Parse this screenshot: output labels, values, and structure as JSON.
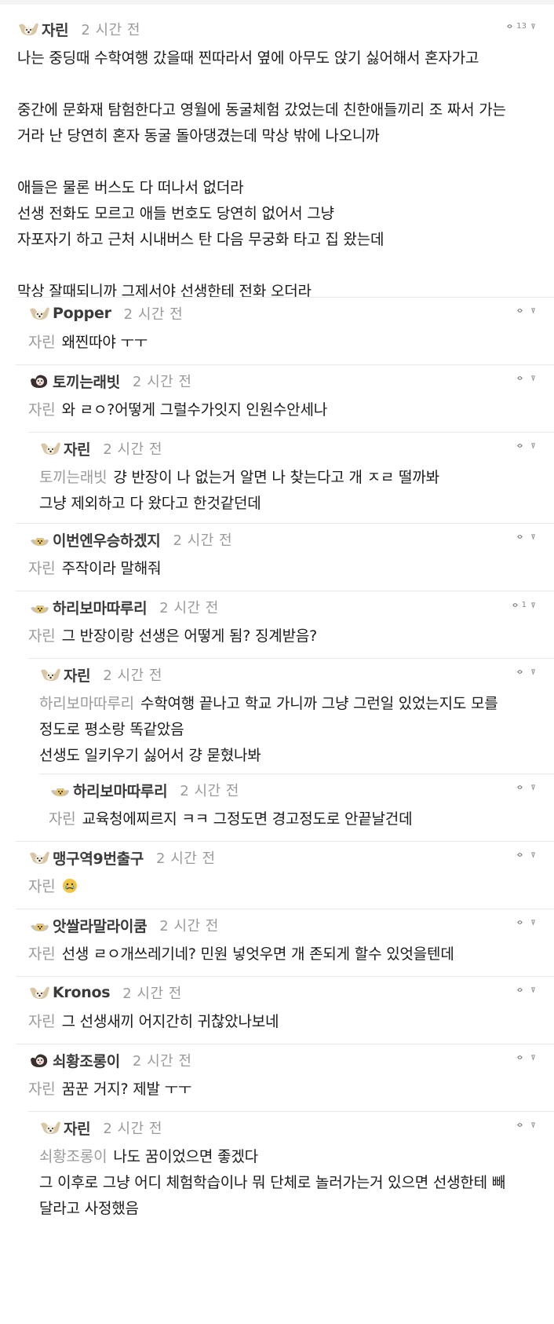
{
  "comments": [
    {
      "nick": "자린",
      "time": "2 시간 전",
      "up": "13",
      "down": "",
      "lines": [
        "나는 중딩때 수학여행 갔을때 찐따라서 옆에 아무도 앉기 싫어해서 혼자가고",
        "",
        "중간에 문화재 탐험한다고 영월에 동굴체험 갔었는데 친한애들끼리 조 짜서 가는",
        "거라 난 당연히 혼자 동굴 돌아댕겼는데 막상 밖에 나오니까",
        "",
        "애들은 물론 버스도 다 떠나서 없더라",
        "선생 전화도 모르고 애들 번호도 당연히 없어서 그냥",
        "자포자기 하고 근처 시내버스 탄 다음 무궁화 타고 집 왔는데",
        "",
        "막상 잘때되니까 그제서야 선생한테 전화 오더라"
      ]
    },
    {
      "nick": "Popper",
      "time": "2 시간 전",
      "up": "",
      "down": "",
      "mention": "자린",
      "lines": [
        "왜찐따야 ㅜㅜ"
      ]
    },
    {
      "nick": "토끼는래빗",
      "time": "2 시간 전",
      "up": "",
      "down": "",
      "mention": "자린",
      "lines": [
        "와 ㄹㅇ?어떻게 그럴수가잇지 인원수안세나"
      ]
    },
    {
      "nick": "자린",
      "time": "2 시간 전",
      "up": "",
      "down": "",
      "mention": "토끼는래빗",
      "lines": [
        "걍 반장이 나 없는거 알면 나 찾는다고 개 ㅈㄹ 떨까봐",
        "그냥 제외하고 다 왔다고 한것같던데"
      ]
    },
    {
      "nick": "이번엔우승하겠지",
      "time": "2 시간 전",
      "up": "",
      "down": "",
      "mention": "자린",
      "lines": [
        "주작이라 말해줘"
      ]
    },
    {
      "nick": "하리보마따루리",
      "time": "2 시간 전",
      "up": "1",
      "down": "",
      "mention": "자린",
      "lines": [
        "그 반장이랑 선생은 어떻게 됨? 징계받음?"
      ]
    },
    {
      "nick": "자린",
      "time": "2 시간 전",
      "up": "",
      "down": "",
      "mention": "하리보마따루리",
      "lines": [
        "수학여행 끝나고 학교 가니까 그냥 그런일 있었는지도 모를",
        "정도로 평소랑 똑같았음",
        "선생도 일키우기 싫어서 걍 묻혔나봐"
      ]
    },
    {
      "nick": "하리보마따루리",
      "time": "2 시간 전",
      "up": "",
      "down": "",
      "mention": "자린",
      "lines": [
        "교육청에찌르지 ㅋㅋ 그정도면 경고정도로 안끝날건데"
      ]
    },
    {
      "nick": "맹구역9번출구",
      "time": "2 시간 전",
      "up": "",
      "down": "",
      "mention": "자린",
      "lines": [
        ""
      ]
    },
    {
      "nick": "앗쌀라말라이쿰",
      "time": "2 시간 전",
      "up": "",
      "down": "",
      "mention": "자린",
      "lines": [
        "선생 ㄹㅇ개쓰레기네? 민원 넣엇우면 개 존되게 할수 있엇을텐데"
      ]
    },
    {
      "nick": "Kronos",
      "time": "2 시간 전",
      "up": "",
      "down": "",
      "mention": "자린",
      "lines": [
        "그 선생새끼 어지간히 귀찮았나보네"
      ]
    },
    {
      "nick": "쇠황조롱이",
      "time": "2 시간 전",
      "up": "",
      "down": "",
      "mention": "자린",
      "lines": [
        "꿈꾼 거지? 제발 ㅜㅜ"
      ]
    },
    {
      "nick": "자린",
      "time": "2 시간 전",
      "up": "",
      "down": "",
      "mention": "쇠황조롱이",
      "lines": [
        "나도 꿈이었으면 좋겠다",
        "그 이후로 그냥 어디 체험학습이나 뭐 단체로 놀러가는거 있으면 선생한테 빼",
        "달라고 사정했음"
      ]
    }
  ]
}
